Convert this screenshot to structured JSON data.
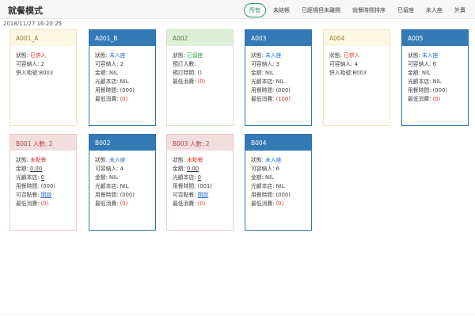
{
  "header": {
    "title": "就餐模式",
    "filters": [
      {
        "label": "所有",
        "active": true
      },
      {
        "label": "未結帳",
        "active": false
      },
      {
        "label": "已經規但未離開",
        "active": false
      },
      {
        "label": "就餐時間排序",
        "active": false
      },
      {
        "label": "已留座",
        "active": false
      },
      {
        "label": "未入座",
        "active": false
      },
      {
        "label": "外賣",
        "active": false
      }
    ]
  },
  "timestamp": "2018/11/27 16:20:25",
  "tables": [
    {
      "name": "A001_A",
      "style": "yellow",
      "rows": [
        {
          "label": "狀態: ",
          "value": "已併入",
          "cls": "v-red"
        },
        {
          "label": "可容納人: ",
          "value": "2",
          "cls": "v-plain"
        },
        {
          "label": "併入枱號:",
          "value": "B003",
          "cls": "v-plain"
        }
      ]
    },
    {
      "name": "A001_B",
      "style": "blue",
      "rows": [
        {
          "label": "狀態: ",
          "value": "未入座",
          "cls": "v-blue"
        },
        {
          "label": "可容納人: ",
          "value": "2",
          "cls": "v-plain"
        },
        {
          "label": "金額: ",
          "value": "NIL",
          "cls": "v-plain"
        },
        {
          "label": "光顧本店: ",
          "value": "NIL",
          "cls": "v-plain"
        },
        {
          "label": "用餐時間: ",
          "value": "(000)",
          "cls": "v-plain"
        },
        {
          "label": "最低消費: ",
          "value": "(0)",
          "cls": "v-red"
        }
      ]
    },
    {
      "name": "A002",
      "style": "green",
      "rows": [
        {
          "label": "狀態: ",
          "value": "已留座",
          "cls": "v-green"
        },
        {
          "label": "預訂人數: ",
          "value": "",
          "cls": "v-plain"
        },
        {
          "label": "預訂時間: ",
          "value": "()",
          "cls": "v-plain"
        },
        {
          "label": "最低消費: ",
          "value": "(0)",
          "cls": "v-red"
        }
      ]
    },
    {
      "name": "A003",
      "style": "blue",
      "rows": [
        {
          "label": "狀態: ",
          "value": "未入座",
          "cls": "v-blue"
        },
        {
          "label": "可容納人: ",
          "value": "3",
          "cls": "v-plain"
        },
        {
          "label": "金額: ",
          "value": "NIL",
          "cls": "v-plain"
        },
        {
          "label": "光顧本店: ",
          "value": "NIL",
          "cls": "v-plain"
        },
        {
          "label": "用餐時間: ",
          "value": "(000)",
          "cls": "v-plain"
        },
        {
          "label": "最低消費: ",
          "value": "(100)",
          "cls": "v-red"
        }
      ]
    },
    {
      "name": "A004",
      "style": "yellow",
      "rows": [
        {
          "label": "狀態: ",
          "value": "已併入",
          "cls": "v-red"
        },
        {
          "label": "可容納人: ",
          "value": "4",
          "cls": "v-plain"
        },
        {
          "label": "併入枱號:",
          "value": "B003",
          "cls": "v-plain"
        }
      ]
    },
    {
      "name": "A005",
      "style": "blue",
      "rows": [
        {
          "label": "狀態: ",
          "value": "未入座",
          "cls": "v-blue"
        },
        {
          "label": "可容納人: ",
          "value": "6",
          "cls": "v-plain"
        },
        {
          "label": "金額: ",
          "value": "NIL",
          "cls": "v-plain"
        },
        {
          "label": "光顧本店: ",
          "value": "NIL",
          "cls": "v-plain"
        },
        {
          "label": "用餐時間: ",
          "value": "(000)",
          "cls": "v-plain"
        },
        {
          "label": "最低消費: ",
          "value": "(0)",
          "cls": "v-red"
        }
      ]
    },
    {
      "name": "B001 人數: 2",
      "style": "red",
      "rows": [
        {
          "label": "狀態: ",
          "value": "未點餐",
          "cls": "v-red"
        },
        {
          "label": "金額: ",
          "value": "0.00",
          "cls": "v-ul"
        },
        {
          "label": "光顧本店: ",
          "value": "0",
          "cls": "v-ul"
        },
        {
          "label": "用餐時間: ",
          "value": "(000)",
          "cls": "v-plain"
        },
        {
          "label": "可否點餐: ",
          "value": "開啟",
          "cls": "v-link"
        },
        {
          "label": "最低消費: ",
          "value": "(0)",
          "cls": "v-red"
        }
      ]
    },
    {
      "name": "B002",
      "style": "blue",
      "rows": [
        {
          "label": "狀態: ",
          "value": "未入座",
          "cls": "v-blue"
        },
        {
          "label": "可容納人: ",
          "value": "4",
          "cls": "v-plain"
        },
        {
          "label": "金額: ",
          "value": "NIL",
          "cls": "v-plain"
        },
        {
          "label": "光顧本店: ",
          "value": "NIL",
          "cls": "v-plain"
        },
        {
          "label": "用餐時間: ",
          "value": "(000)",
          "cls": "v-plain"
        },
        {
          "label": "最低消費: ",
          "value": "(0)",
          "cls": "v-red"
        }
      ]
    },
    {
      "name": "B003 人數: 2",
      "style": "red",
      "rows": [
        {
          "label": "狀態: ",
          "value": "未點餐",
          "cls": "v-red"
        },
        {
          "label": "金額: ",
          "value": "0.00",
          "cls": "v-ul"
        },
        {
          "label": "光顧本店: ",
          "value": "0",
          "cls": "v-ul"
        },
        {
          "label": "用餐時間: ",
          "value": "(001)",
          "cls": "v-plain"
        },
        {
          "label": "可否點餐: ",
          "value": "開啟",
          "cls": "v-link"
        },
        {
          "label": "最低消費: ",
          "value": "(0)",
          "cls": "v-red"
        }
      ]
    },
    {
      "name": "B004",
      "style": "blue",
      "rows": [
        {
          "label": "狀態: ",
          "value": "未入座",
          "cls": "v-blue"
        },
        {
          "label": "可容納人: ",
          "value": "6",
          "cls": "v-plain"
        },
        {
          "label": "金額: ",
          "value": "NIL",
          "cls": "v-plain"
        },
        {
          "label": "光顧本店: ",
          "value": "NIL",
          "cls": "v-plain"
        },
        {
          "label": "用餐時間: ",
          "value": "(000)",
          "cls": "v-plain"
        },
        {
          "label": "最低消費: ",
          "value": "(0)",
          "cls": "v-red"
        }
      ]
    }
  ],
  "colors": {
    "accent_green": "#2aa06a",
    "blue_header": "#337ab7",
    "yellow_header": "#fcf8e3",
    "green_header": "#dff0d8",
    "red_header": "#f2dede",
    "status_red": "#e2342c",
    "status_blue": "#2a6fd1"
  }
}
